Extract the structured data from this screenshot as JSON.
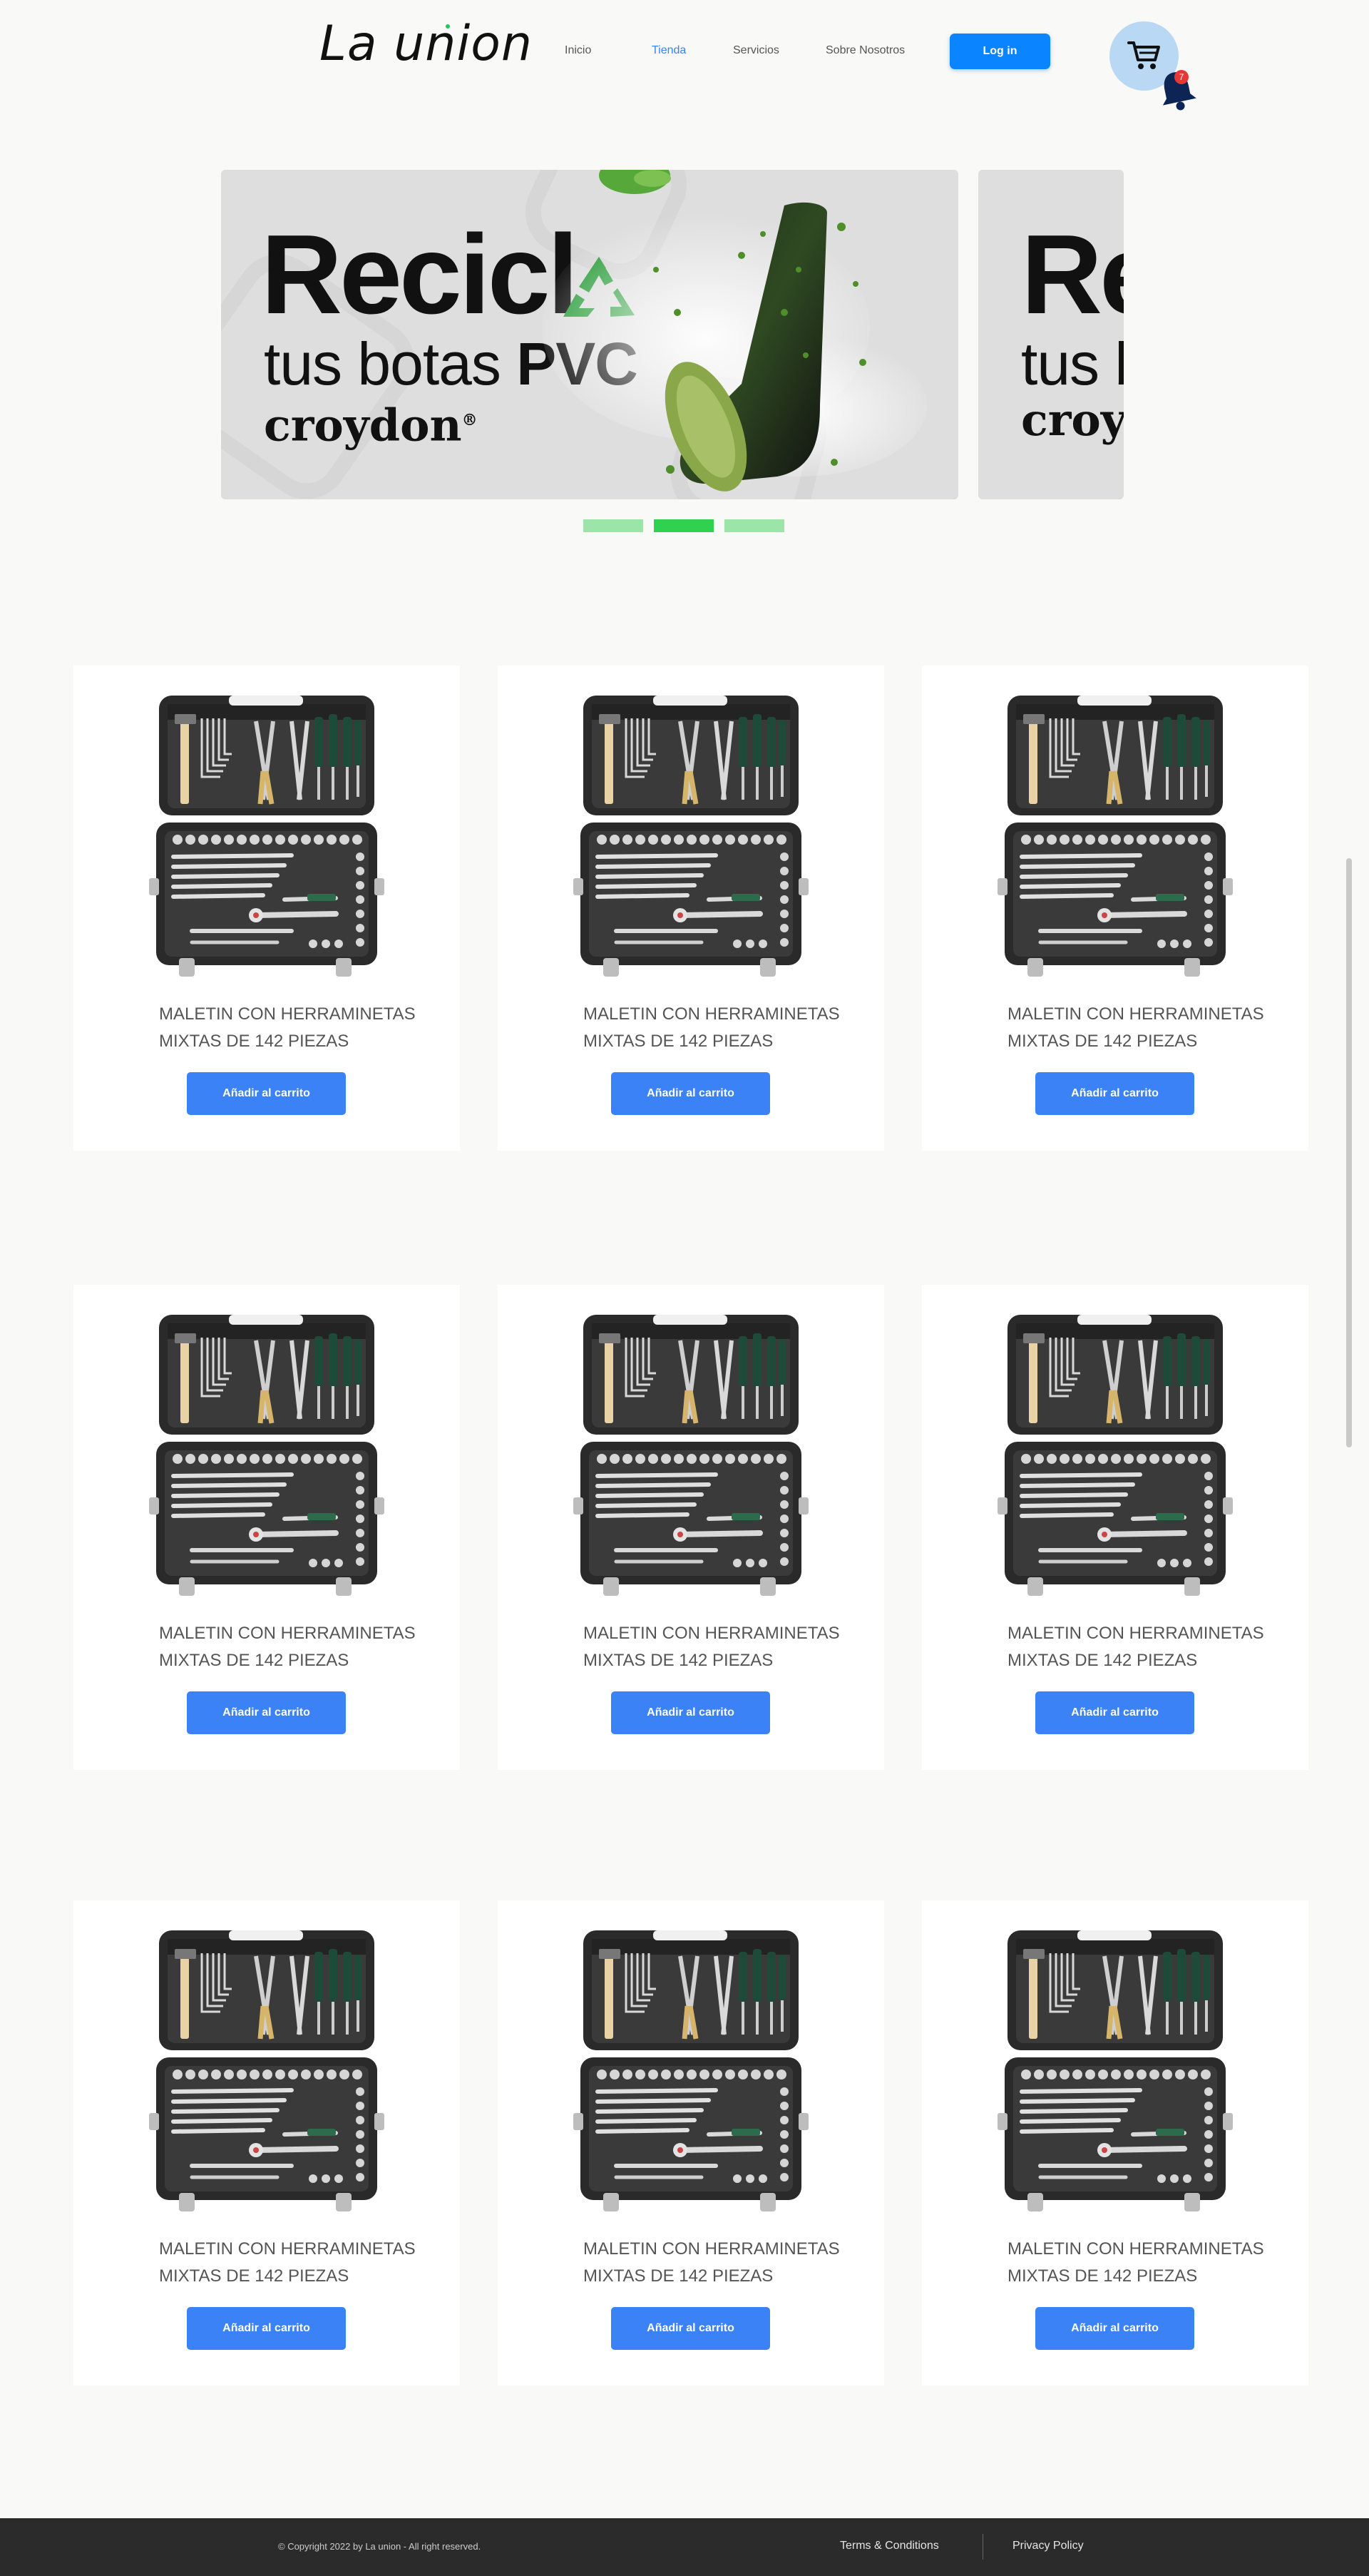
{
  "header": {
    "logo": "La union",
    "nav": [
      {
        "label": "Inicio",
        "active": false
      },
      {
        "label": "Tienda",
        "active": true
      },
      {
        "label": "Servicios",
        "active": false
      },
      {
        "label": "Sobre Nosotros",
        "active": false
      }
    ],
    "login_label": "Log in",
    "cart_icon": "cart-icon",
    "bell_icon": "bell-icon",
    "notification_count": "7"
  },
  "carousel": {
    "slide_main": {
      "headline": "Recicl",
      "recycle_icon": "recycle-icon",
      "line2_light": "tus botas",
      "line2_bold": "PVC",
      "brand": "croydon",
      "registered": "®"
    },
    "slide_peek": {
      "headline": "Re",
      "line2": "tus b",
      "brand": "croy"
    },
    "active_dot_index": 1,
    "dot_count": 3
  },
  "products": [
    {
      "title": "MALETIN CON HERRAMINETAS MIXTAS DE 142 PIEZAS",
      "button": "Añadir al carrito"
    },
    {
      "title": "MALETIN CON HERRAMINETAS MIXTAS DE 142 PIEZAS",
      "button": "Añadir al carrito"
    },
    {
      "title": "MALETIN CON HERRAMINETAS MIXTAS DE 142 PIEZAS",
      "button": "Añadir al carrito"
    },
    {
      "title": "MALETIN CON HERRAMINETAS MIXTAS DE 142 PIEZAS",
      "button": "Añadir al carrito"
    },
    {
      "title": "MALETIN CON HERRAMINETAS MIXTAS DE 142 PIEZAS",
      "button": "Añadir al carrito"
    },
    {
      "title": "MALETIN CON HERRAMINETAS MIXTAS DE 142 PIEZAS",
      "button": "Añadir al carrito"
    },
    {
      "title": "MALETIN CON HERRAMINETAS MIXTAS DE 142 PIEZAS",
      "button": "Añadir al carrito"
    },
    {
      "title": "MALETIN CON HERRAMINETAS MIXTAS DE 142 PIEZAS",
      "button": "Añadir al carrito"
    },
    {
      "title": "MALETIN CON HERRAMINETAS MIXTAS DE 142 PIEZAS",
      "button": "Añadir al carrito"
    }
  ],
  "footer": {
    "copyright": "© Copyright 2022 by La union - All right reserved.",
    "terms": "Terms & Conditions",
    "privacy": "Privacy Policy"
  },
  "colors": {
    "accent": "#0a84ff",
    "button": "#3b82f6",
    "active_dot": "#2fd14f",
    "inactive_dot": "#9be5a8",
    "footer_bg": "#2b2b2b"
  }
}
